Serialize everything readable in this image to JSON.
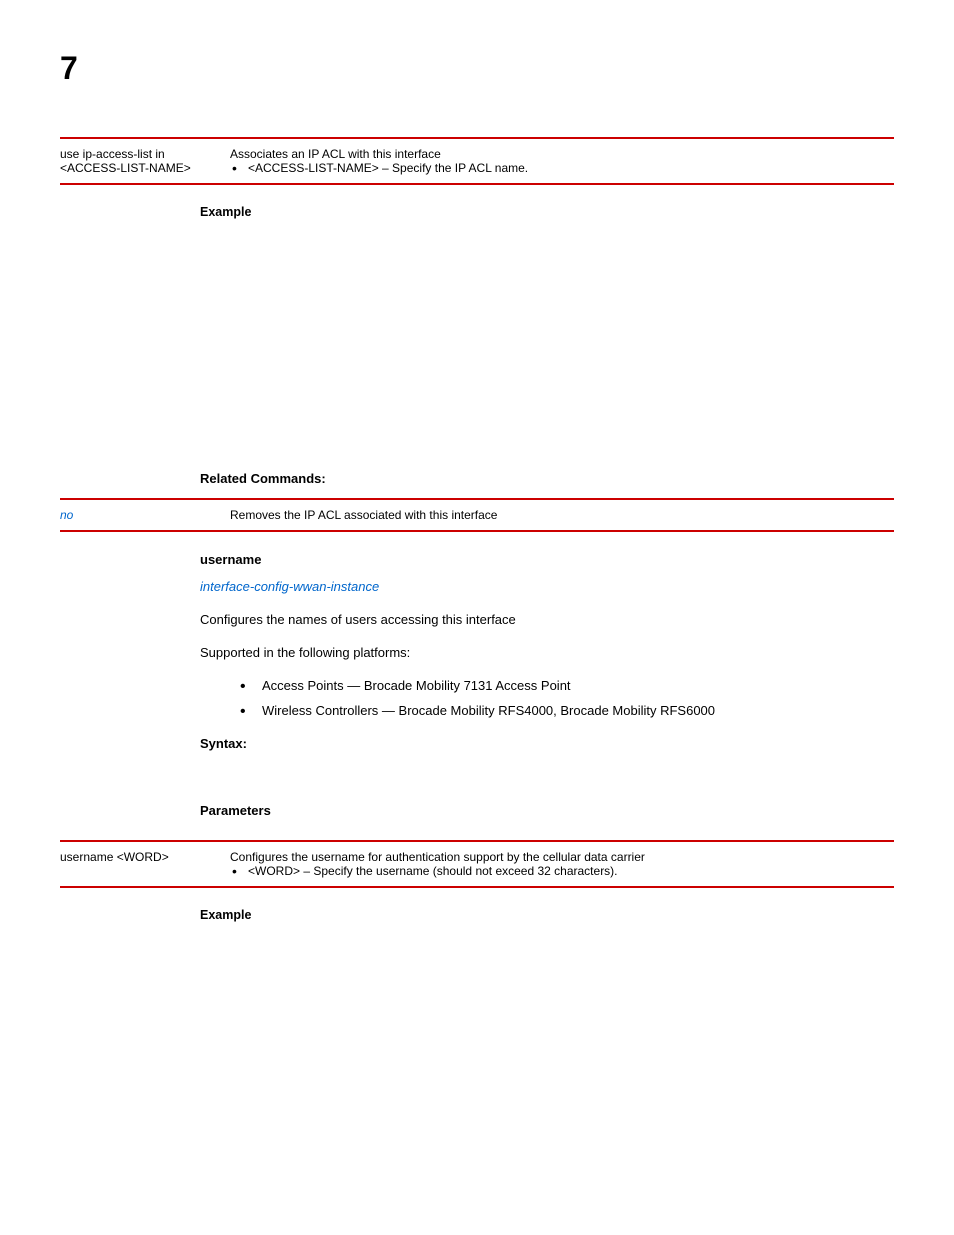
{
  "page_number": "7",
  "table1": {
    "left_line1": "use ip-access-list in",
    "left_line2": "<ACCESS-LIST-NAME>",
    "right_line1": "Associates an IP ACL with this interface",
    "right_bullet": "<ACCESS-LIST-NAME> – Specify the IP ACL name."
  },
  "example_label": "Example",
  "related_heading": "Related Commands:",
  "related": {
    "cmd": "no",
    "desc": "Removes the IP ACL associated with this interface"
  },
  "username_section": {
    "heading": "username",
    "link": "interface-config-wwan-instance",
    "desc": "Configures the names of users accessing this interface",
    "supported": "Supported in the following platforms:",
    "platform1": "Access Points — Brocade Mobility 7131 Access Point",
    "platform2": "Wireless Controllers — Brocade Mobility RFS4000, Brocade Mobility RFS6000"
  },
  "syntax_label": "Syntax:",
  "parameters_label": "Parameters",
  "table2": {
    "left": "username <WORD>",
    "right_line1": "Configures the username for authentication support by the cellular data carrier",
    "right_bullet": "<WORD> – Specify the username (should not exceed 32 characters)."
  }
}
